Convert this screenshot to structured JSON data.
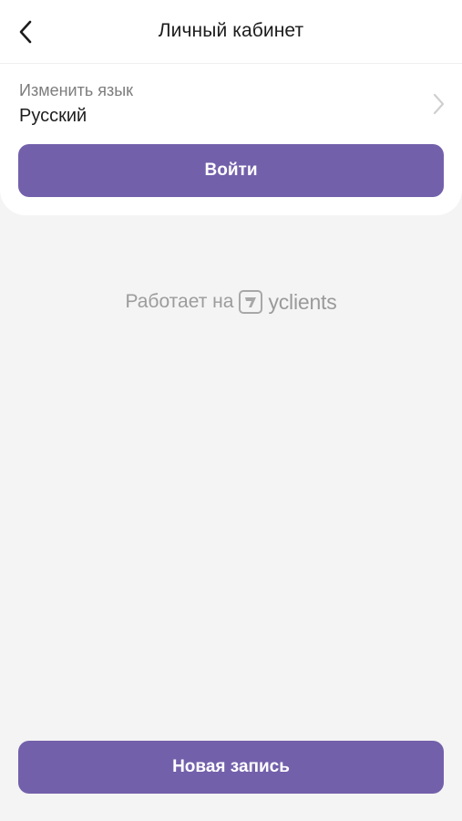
{
  "header": {
    "title": "Личный кабинет",
    "back_icon": "chevron-left-icon"
  },
  "language": {
    "caption": "Изменить язык",
    "value": "Русский",
    "chevron_icon": "chevron-right-icon"
  },
  "login_button": {
    "label": "Войти"
  },
  "powered_by": {
    "text": "Работает на",
    "logo_icon": "yclients-logo-icon",
    "brand": "yclients"
  },
  "new_booking_button": {
    "label": "Новая запись"
  },
  "colors": {
    "accent": "#7360ab",
    "background": "#f4f4f4",
    "surface": "#ffffff",
    "muted_text": "#9c9c9c"
  }
}
